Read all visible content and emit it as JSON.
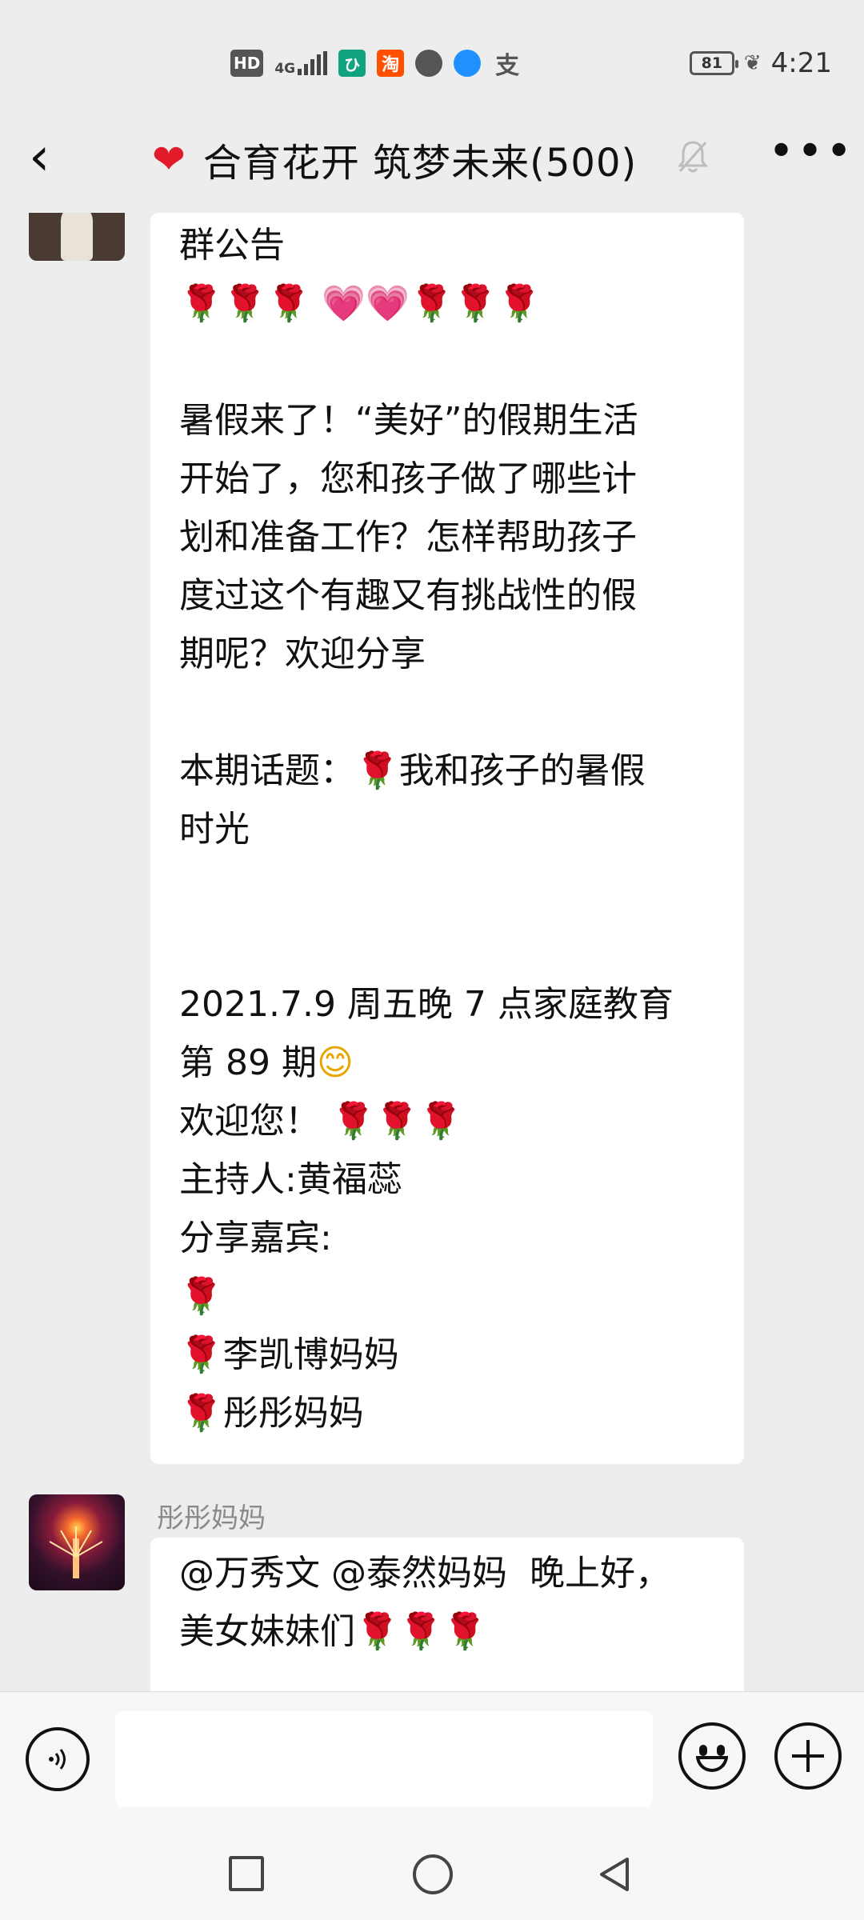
{
  "status_bar": {
    "hd": "HD",
    "network": "4G",
    "taobao_label": "淘",
    "zfb_label": "支",
    "battery": "81",
    "time": "4:21"
  },
  "header": {
    "title": "合育花开 筑梦未来(500)",
    "icons": [
      "back-arrow-icon",
      "heart-icon",
      "mute-bell-icon",
      "more-icon"
    ]
  },
  "messages": [
    {
      "sender": "",
      "lines": [
        "群公告",
        "🌹🌹🌹 💗💗🌹🌹🌹",
        "",
        "暑假来了！“美好”的假期生活",
        "开始了，您和孩子做了哪些计",
        "划和准备工作？怎样帮助孩子",
        "度过这个有趣又有挑战性的假",
        "期呢？欢迎分享",
        "",
        "本期话题：🌹我和孩子的暑假",
        "时光",
        "",
        "",
        "2021.7.9 周五晚 7 点家庭教育",
        "第 89 期😊",
        "欢迎您！ 🌹🌹🌹",
        "主持人:黄福蕊",
        "分享嘉宾:",
        "🌹",
        "🌹李凯博妈妈",
        "🌹彤彤妈妈"
      ]
    },
    {
      "sender": "彤彤妈妈",
      "lines": [
        "@万秀文 @泰然妈妈  晚上好，",
        "美女妹妹们🌹🌹🌹"
      ]
    }
  ],
  "input": {
    "value": "",
    "placeholder": ""
  },
  "colors": {
    "background": "#ededed",
    "bubble": "#ffffff",
    "rose": "#d0101c",
    "heart": "#e21b2b"
  }
}
